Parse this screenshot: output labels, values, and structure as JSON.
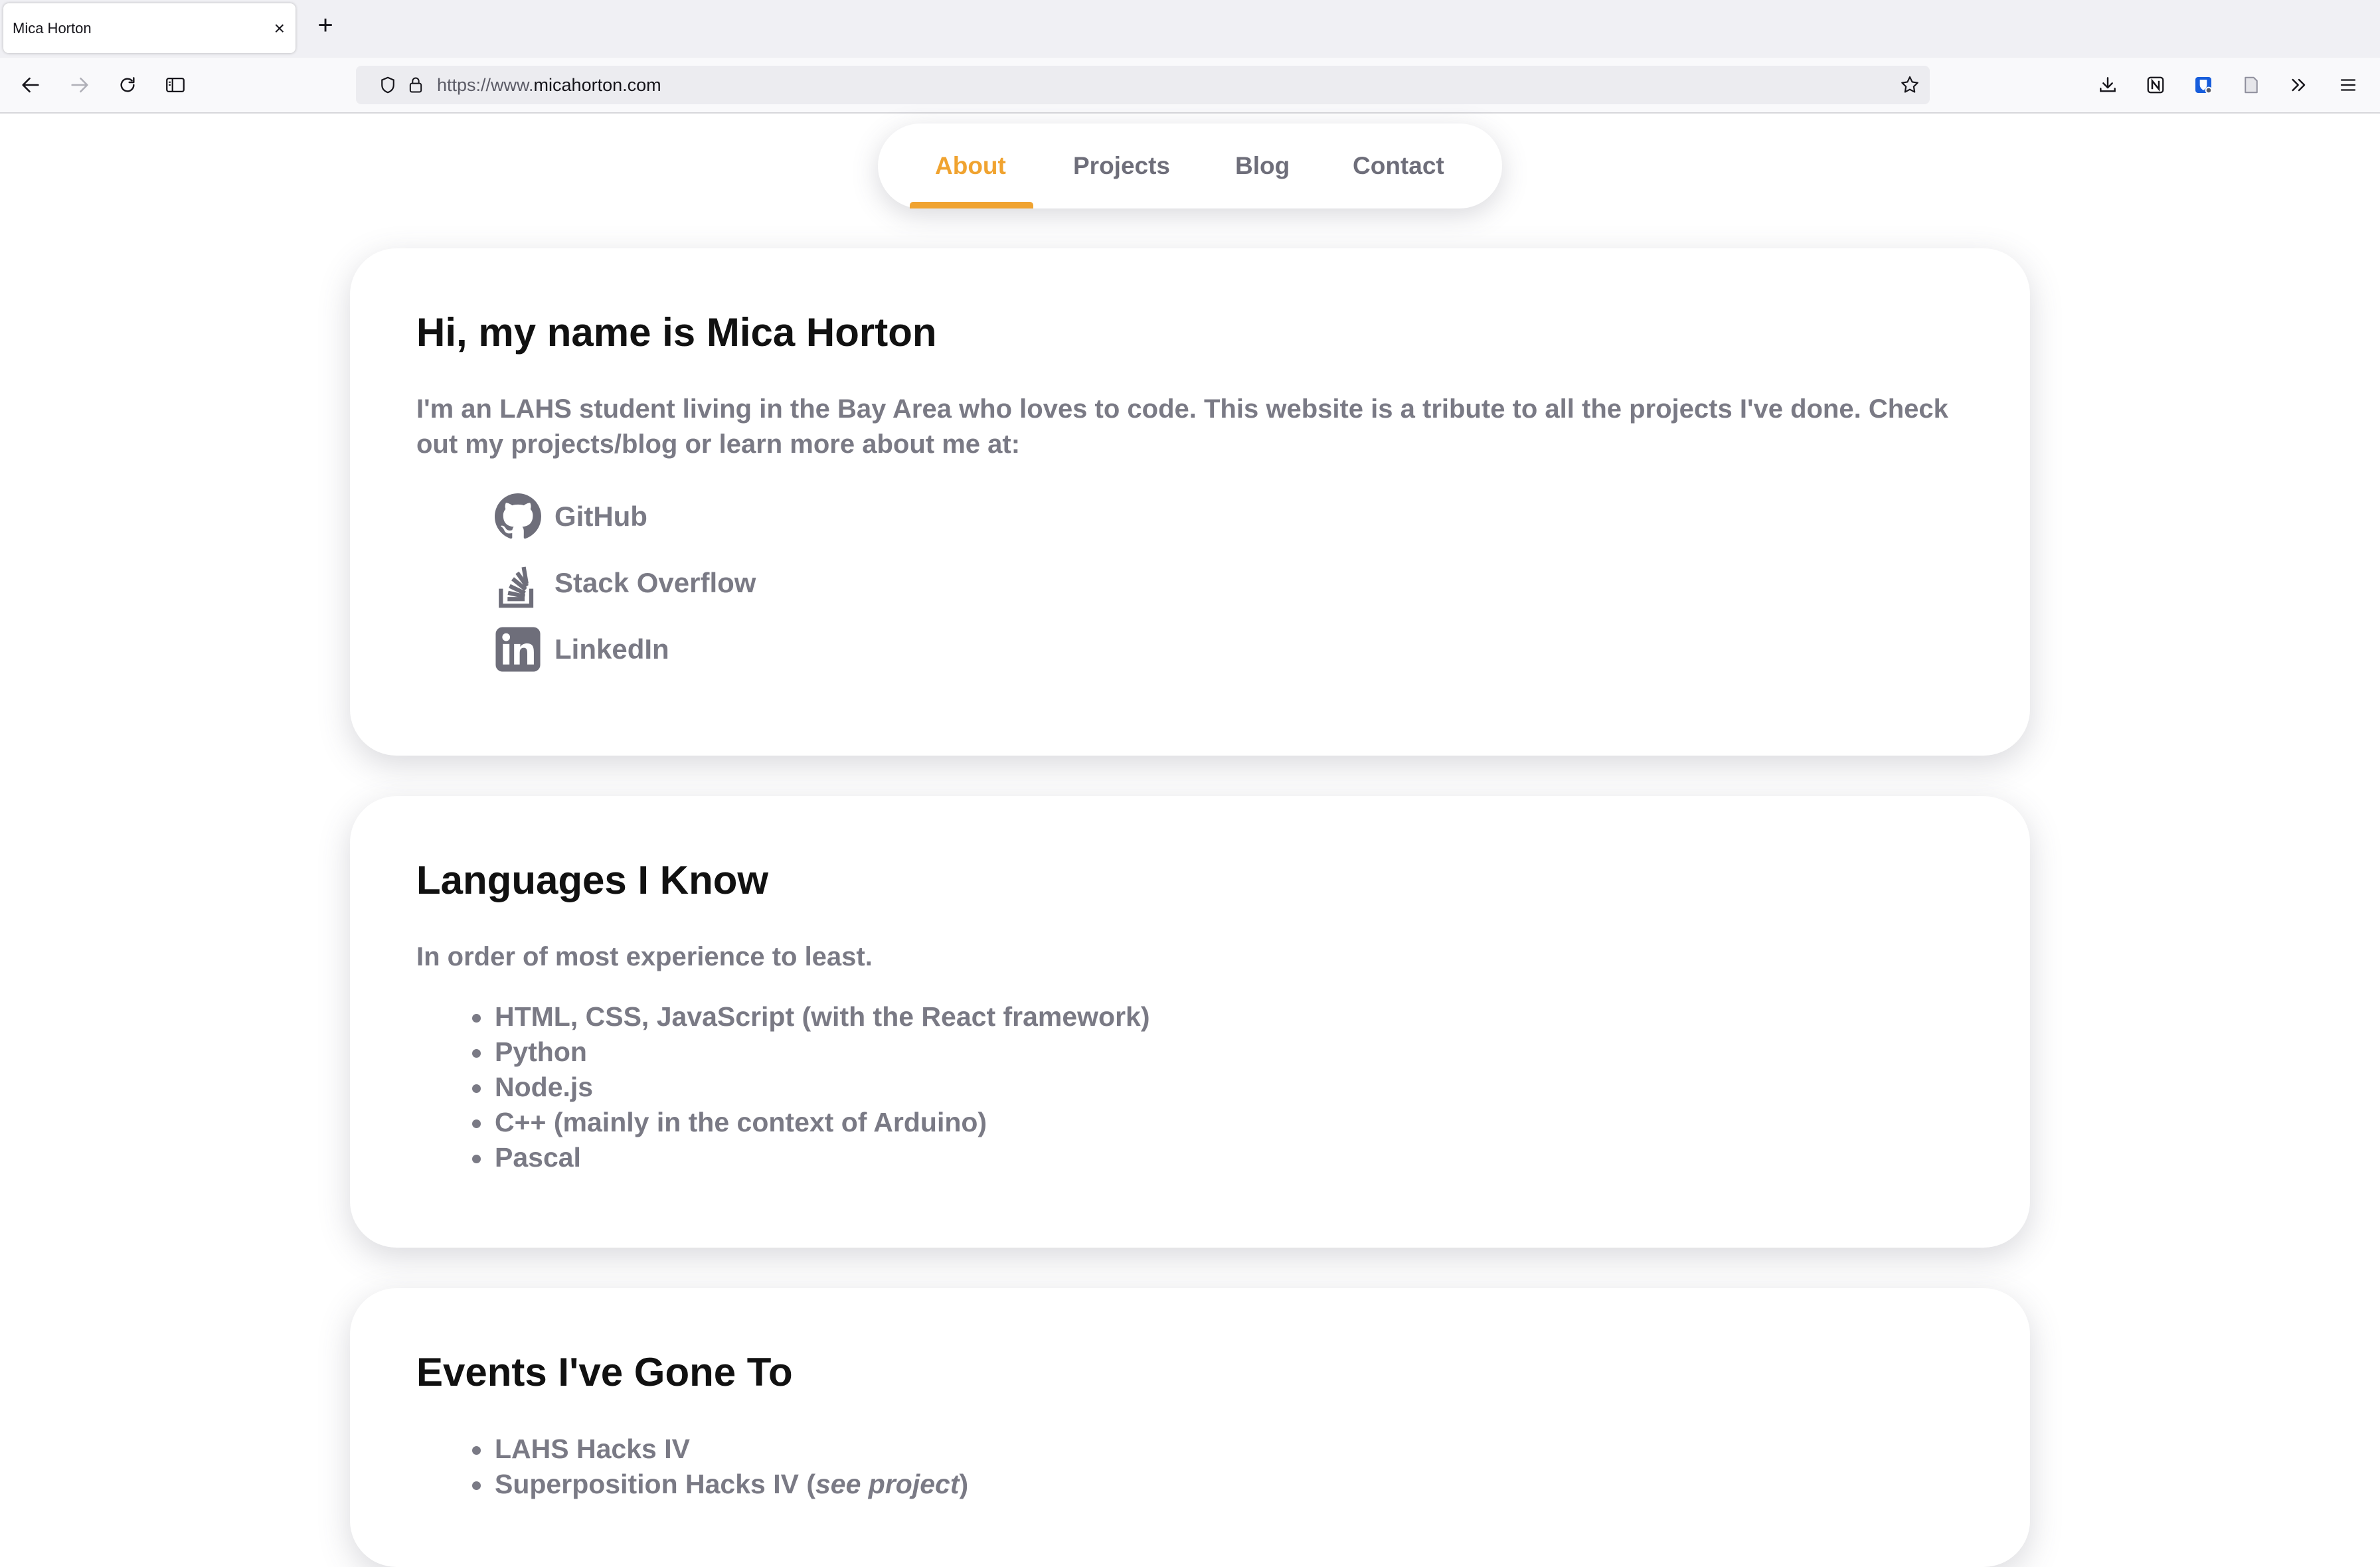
{
  "browser": {
    "tab_title": "Mica Horton",
    "tab_close": "×",
    "new_tab": "+",
    "url_prefix": "https://www.",
    "url_host": "micahorton.com"
  },
  "sitenav": {
    "items": [
      {
        "label": "About",
        "active": true
      },
      {
        "label": "Projects",
        "active": false
      },
      {
        "label": "Blog",
        "active": false
      },
      {
        "label": "Contact",
        "active": false
      }
    ],
    "accent_color": "#f0a330"
  },
  "about": {
    "heading": "Hi, my name is Mica Horton",
    "intro": "I'm an LAHS student living in the Bay Area who loves to code. This website is a tribute to all the projects I've done. Check out my projects/blog or learn more about me at:",
    "links": [
      {
        "label": "GitHub",
        "icon": "github-icon"
      },
      {
        "label": "Stack Overflow",
        "icon": "stack-overflow-icon"
      },
      {
        "label": "LinkedIn",
        "icon": "linkedin-icon"
      }
    ]
  },
  "languages": {
    "heading": "Languages I Know",
    "subtitle": "In order of most experience to least.",
    "items": [
      "HTML, CSS, JavaScript (with the React framework)",
      "Python",
      "Node.js",
      "C++ (mainly in the context of Arduino)",
      "Pascal"
    ]
  },
  "events": {
    "heading": "Events I've Gone To",
    "items": [
      {
        "text": "LAHS Hacks IV"
      },
      {
        "text": "Superposition Hacks IV (",
        "link": "see project",
        "suffix": ")"
      }
    ]
  }
}
